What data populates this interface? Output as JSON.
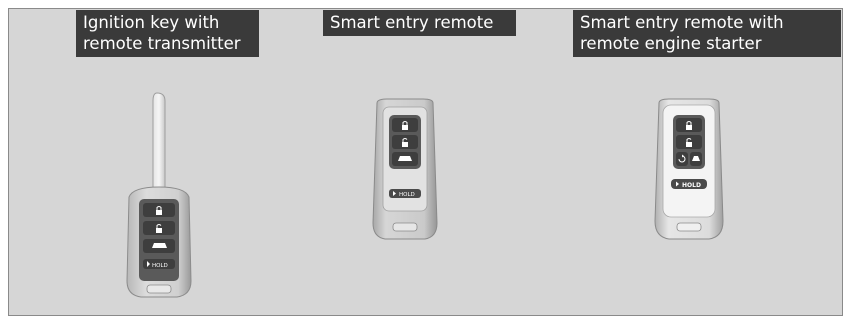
{
  "captions": {
    "ignition_key": "Ignition key with\nremote transmitter",
    "smart_entry": "Smart entry remote",
    "smart_entry_starter": "Smart entry remote with\nremote engine starter"
  },
  "buttons": {
    "hold_label": "HOLD"
  },
  "colors": {
    "background": "#d6d6d6",
    "caption_bg": "#3a3a3a",
    "caption_text": "#ffffff",
    "fob_button": "#4a4a4a"
  },
  "icons": [
    "lock-icon",
    "unlock-icon",
    "trunk-icon",
    "remote-start-icon",
    "panic-icon"
  ]
}
